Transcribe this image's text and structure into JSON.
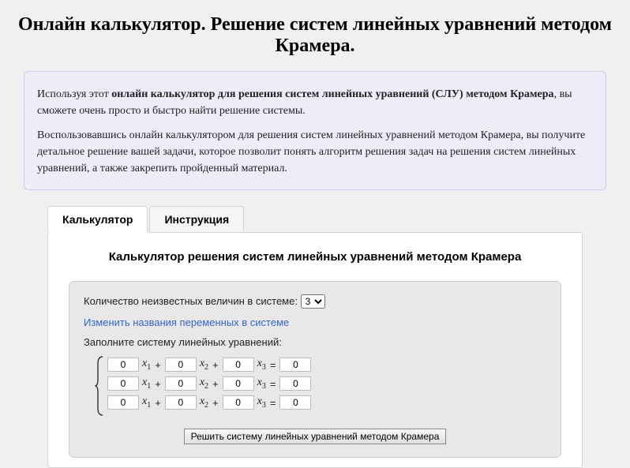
{
  "title": "Онлайн калькулятор. Решение систем линейных уравнений методом Крамера.",
  "info": {
    "p1_prefix": "Используя этот ",
    "p1_bold": "онлайн калькулятор для решения систем линейных уравнений (СЛУ) методом Крамера",
    "p1_suffix": ", вы сможете очень просто и быстро найти решение системы.",
    "p2": "Воспользовавшись онлайн калькулятором для решения систем линейных уравнений методом Крамера, вы получите детальное решение вашей задачи, которое позволит понять алгоритм решения задач на решения систем линейных уравнений, а также закрепить пройденный материал."
  },
  "tabs": {
    "calc": "Калькулятор",
    "instr": "Инструкция"
  },
  "calc": {
    "heading": "Калькулятор решения систем линейных уравнений методом Крамера",
    "count_label": "Количество неизвестных величин в системе:",
    "count_value": "3",
    "change_vars": "Изменить названия переменных в системе",
    "fill_label": "Заполните систему линейных уравнений:",
    "vars": {
      "x": "x",
      "s1": "1",
      "s2": "2",
      "s3": "3"
    },
    "rows": [
      {
        "a1": "0",
        "a2": "0",
        "a3": "0",
        "b": "0"
      },
      {
        "a1": "0",
        "a2": "0",
        "a3": "0",
        "b": "0"
      },
      {
        "a1": "0",
        "a2": "0",
        "a3": "0",
        "b": "0"
      }
    ],
    "plus": "+",
    "eq": "=",
    "solve": "Решить систему линейных уравнений методом Крамера"
  }
}
